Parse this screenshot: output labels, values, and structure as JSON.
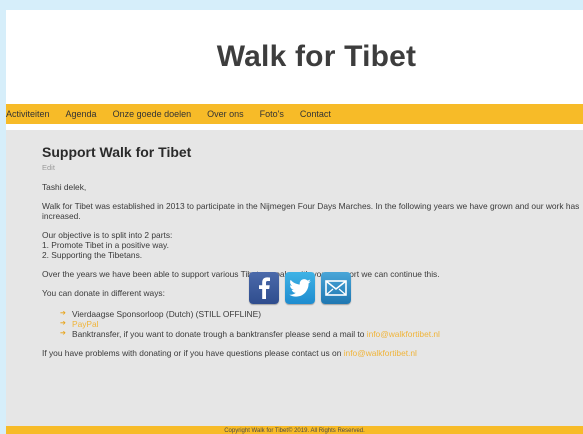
{
  "header": {
    "title": "Walk for Tibet"
  },
  "nav": {
    "items": [
      {
        "label": "Activiteiten"
      },
      {
        "label": "Agenda"
      },
      {
        "label": "Onze goede doelen"
      },
      {
        "label": "Over ons"
      },
      {
        "label": "Foto's"
      },
      {
        "label": "Contact"
      }
    ]
  },
  "article": {
    "heading": "Support Walk for Tibet",
    "edit_label": "Edit",
    "greeting": "Tashi delek,",
    "intro": "Walk for Tibet was established in 2013 to participate in the Nijmegen Four Days Marches. In the following years we have grown and our work has increased.",
    "objective_lines": [
      "Our objective is to split into 2 parts:",
      "1. Promote Tibet in a positive way.",
      "2. Supporting the Tibetans."
    ],
    "support_text": "Over the years we have been able to support various Tibetan goals, with your support we can continue this.",
    "donate_intro": "You can donate in different ways:",
    "donate_options": {
      "sponsorloop": "Vierdaagse Sponsorloop (Dutch) (STILL OFFLINE)",
      "paypal": "PayPal",
      "banktransfer_text": "Banktransfer, if you want to donate trough a banktransfer please send a mail to ",
      "banktransfer_email": "info@walkfortibet.nl"
    },
    "questions_text": "If you have problems with donating or if you have questions please contact us on ",
    "questions_email": "info@walkfortibet.nl"
  },
  "social": {
    "facebook_icon": "facebook-icon",
    "twitter_icon": "twitter-icon",
    "mail_icon": "mail-icon"
  },
  "footer": {
    "text": "Copyright Walk for Tibet© 2019. All Rights Reserved."
  },
  "colors": {
    "accent": "#f7bb28",
    "link": "#f0b43a",
    "content_bg": "#e6e6e6",
    "outer_bg": "#d6eefa"
  }
}
